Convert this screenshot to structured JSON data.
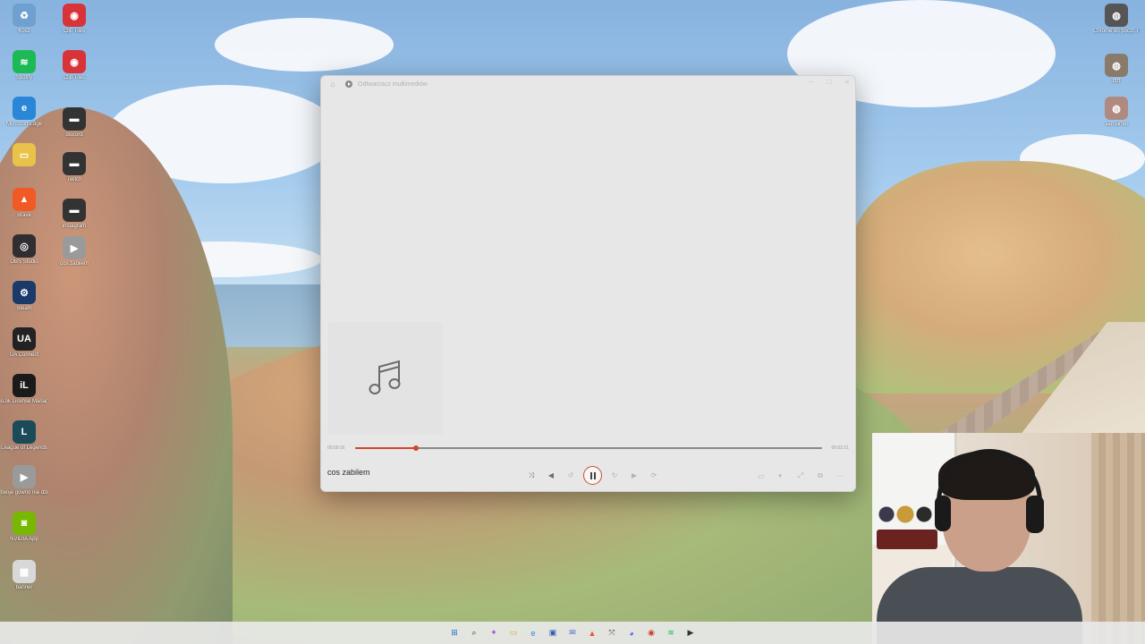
{
  "desktop": {
    "icons": [
      {
        "label": "Kosz",
        "icon": "recycle-bin-icon",
        "color": "#6fa0d0"
      },
      {
        "label": "Clip Tiles",
        "icon": "app-red-icon",
        "color": "#d9333a"
      },
      {
        "label": "Spotify",
        "icon": "spotify-icon",
        "color": "#1db954"
      },
      {
        "label": "Clip Tiles",
        "icon": "app-red-icon",
        "color": "#d9333a"
      },
      {
        "label": "Microsoft Edge",
        "icon": "edge-icon",
        "color": "#2a86d6"
      },
      {
        "label": "discord",
        "icon": "shortcut-icon",
        "color": "#333333"
      },
      {
        "label": "",
        "icon": "folder-icon",
        "color": "#e9c24a"
      },
      {
        "label": "Twitch",
        "icon": "shortcut-icon",
        "color": "#333333"
      },
      {
        "label": "Brave",
        "icon": "brave-icon",
        "color": "#f05a24"
      },
      {
        "label": "instagram",
        "icon": "shortcut-icon",
        "color": "#333333"
      },
      {
        "label": "OBS Studio",
        "icon": "obs-icon",
        "color": "#302e31"
      },
      {
        "label": "cos zabilem",
        "icon": "media-file-icon",
        "color": "#9a9a9a"
      },
      {
        "label": "Steam",
        "icon": "steam-icon",
        "color": "#1b3a6a"
      },
      {
        "label": "UA Connect",
        "icon": "ua-icon",
        "color": "#222222"
      },
      {
        "label": "iLok License Manager",
        "icon": "ilok-icon",
        "color": "#1a1a1a"
      },
      {
        "label": "League of Legends",
        "icon": "lol-icon",
        "color": "#1b4a5a"
      },
      {
        "label": "twoje gowno nie dziala",
        "icon": "media-file-icon",
        "color": "#9a9a9a"
      },
      {
        "label": "NVIDIA App",
        "icon": "nvidia-icon",
        "color": "#76b900"
      },
      {
        "label": "banner",
        "icon": "image-file-icon",
        "color": "#d8d8d8"
      }
    ],
    "right_icons": [
      {
        "label": "Chrome do poczt. i ot... drugie okno",
        "icon": "chrome-shortcut-icon",
        "color": "#555555"
      },
      {
        "label": "ttttt",
        "icon": "image-thumb-icon",
        "color": "#8a7a6a"
      },
      {
        "label": "samsimel",
        "icon": "image-thumb-icon",
        "color": "#b08a80"
      }
    ]
  },
  "player": {
    "window_title": "Odtwarzacz multimediów",
    "track_name": "cos zabilem",
    "time_elapsed": "00:00:16",
    "time_total": "00:02:21",
    "progress": 0.13,
    "accent_color": "#d2452b",
    "album_art_icon": "music-note-icon",
    "controls": {
      "shuffle": "shuffle-icon",
      "previous": "previous-icon",
      "rewind": "rewind-10-icon",
      "play_pause": "pause-icon",
      "forward": "forward-30-icon",
      "next": "next-icon",
      "repeat": "repeat-icon"
    },
    "extra_controls": [
      "cast-icon",
      "volume-icon",
      "fullscreen-icon",
      "miniplayer-icon",
      "more-icon"
    ]
  },
  "taskbar": {
    "items": [
      "start-icon",
      "search-icon",
      "copilot-icon",
      "file-explorer-icon",
      "edge-icon",
      "store-icon",
      "teams-icon",
      "brave-icon",
      "pinned-app-icon",
      "discord-icon",
      "chrome-icon",
      "spotify-icon",
      "media-player-icon"
    ]
  }
}
